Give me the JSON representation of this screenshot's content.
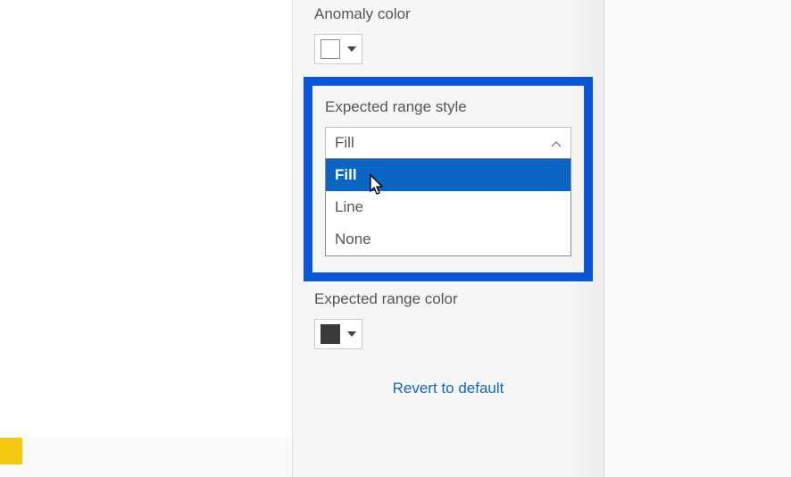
{
  "pane": {
    "anomaly_color_label": "Anomaly color",
    "anomaly_color_value": "#ffffff",
    "expected_range_style_label": "Expected range style",
    "expected_range_style_value": "Fill",
    "expected_range_style_options": {
      "fill": "Fill",
      "line": "Line",
      "none": "None"
    },
    "expected_range_color_label": "Expected range color",
    "expected_range_color_value": "#3a3a3a",
    "revert_label": "Revert to default"
  },
  "colors": {
    "highlight": "#0957d8",
    "selection": "#0a66c2",
    "accent": "#f2c811"
  }
}
